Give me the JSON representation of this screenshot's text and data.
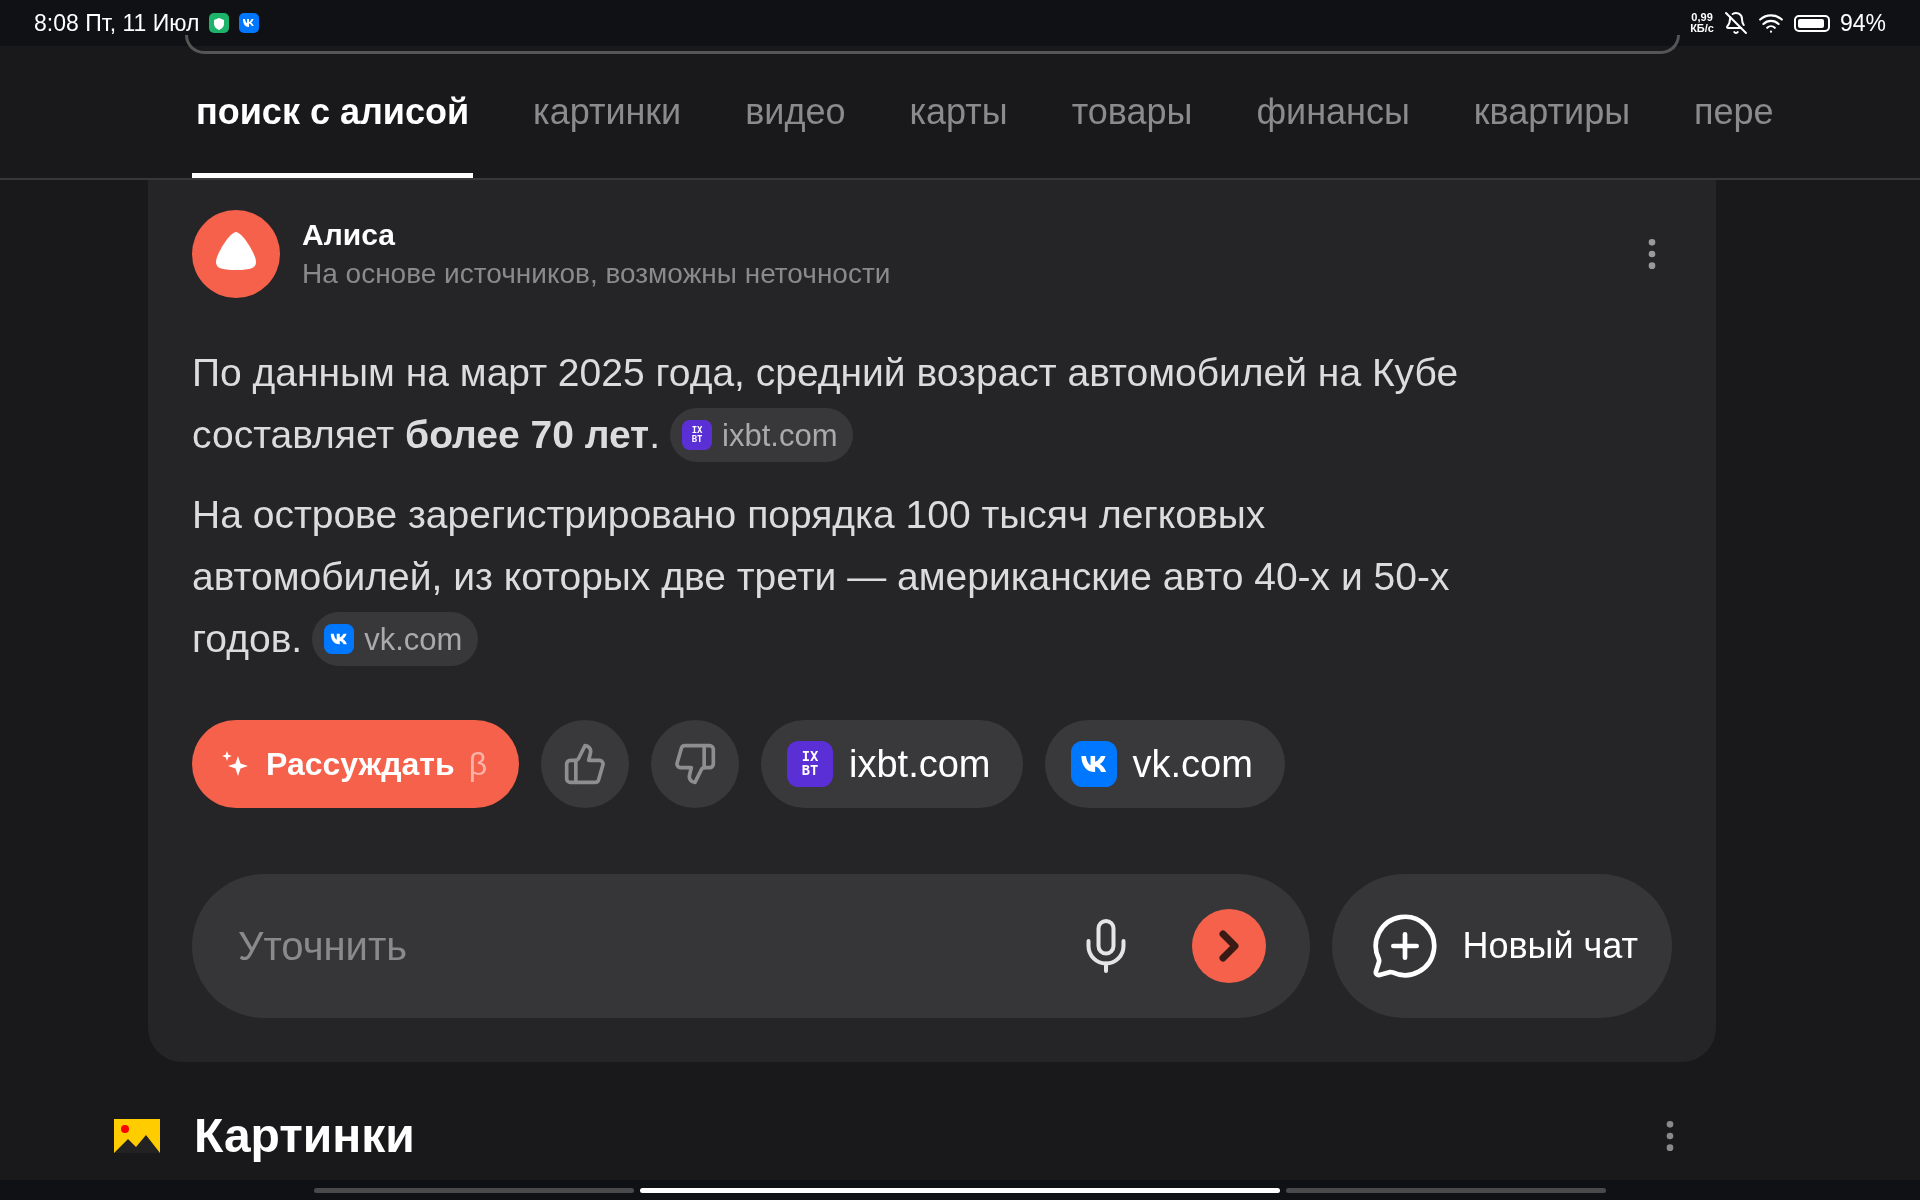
{
  "status_bar": {
    "time": "8:08 Пт, 11 Июл",
    "speed": [
      "0,99",
      "КБ/с"
    ],
    "battery": "94%"
  },
  "tabs": [
    {
      "label": "поиск с алисой",
      "selected": true
    },
    {
      "label": "картинки",
      "selected": false
    },
    {
      "label": "видео",
      "selected": false
    },
    {
      "label": "карты",
      "selected": false
    },
    {
      "label": "товары",
      "selected": false
    },
    {
      "label": "финансы",
      "selected": false
    },
    {
      "label": "квартиры",
      "selected": false
    },
    {
      "label": "пере",
      "selected": false
    }
  ],
  "answer": {
    "author": "Алиса",
    "subtitle": "На основе источников, возможны неточности",
    "paragraphs": [
      {
        "lines": [
          "По данным на март 2025 года, средний возраст автомобилей на Кубе",
          "составляет **более 70 лет**."
        ],
        "source": {
          "kind": "ixbt",
          "name": "ixbt.com",
          "logo": [
            "IX",
            "BT"
          ]
        }
      },
      {
        "lines": [
          "На острове зарегистрировано порядка 100 тысяч легковых",
          "автомобилей, из которых две трети — американские авто 40-х и 50-х",
          "годов."
        ],
        "source": {
          "kind": "vk",
          "name": "vk.com"
        }
      }
    ],
    "reason_button": {
      "label": "Рассуждать",
      "badge": "β"
    },
    "sources": [
      {
        "kind": "ixbt",
        "name": "ixbt.com",
        "logo": [
          "IX",
          "BT"
        ]
      },
      {
        "kind": "vk",
        "name": "vk.com"
      }
    ],
    "input": {
      "placeholder": "Уточнить"
    },
    "new_chat": "Новый чат"
  },
  "section": {
    "title": "Картинки"
  }
}
